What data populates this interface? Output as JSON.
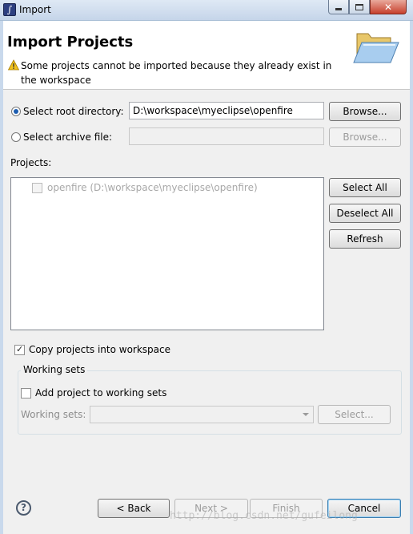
{
  "window": {
    "title": "Import"
  },
  "banner": {
    "title": "Import Projects",
    "message": "Some projects cannot be imported because they already exist in the workspace"
  },
  "source": {
    "root_label": "Select root directory:",
    "root_value": "D:\\workspace\\myeclipse\\openfire",
    "root_browse": "Browse...",
    "archive_label": "Select archive file:",
    "archive_value": "",
    "archive_browse": "Browse..."
  },
  "projects": {
    "label": "Projects:",
    "items": [
      {
        "label": "openfire (D:\\workspace\\myeclipse\\openfire)",
        "checked": false
      }
    ],
    "select_all": "Select All",
    "deselect_all": "Deselect All",
    "refresh": "Refresh"
  },
  "options": {
    "copy_label": "Copy projects into workspace",
    "copy_checked": true
  },
  "working_sets": {
    "group_title": "Working sets",
    "add_label": "Add project to working sets",
    "sets_label": "Working sets:",
    "sets_value": "",
    "select_button": "Select..."
  },
  "footer": {
    "help_glyph": "?",
    "back": "< Back",
    "next": "Next >",
    "finish": "Finish",
    "cancel": "Cancel"
  },
  "watermark": "http://blog.csdn.net/gufeilong"
}
